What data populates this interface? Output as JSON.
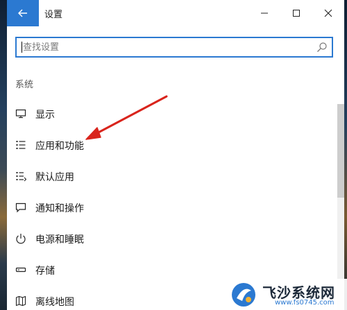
{
  "window": {
    "title": "设置"
  },
  "search": {
    "placeholder": "查找设置",
    "value": ""
  },
  "section": {
    "title": "系统"
  },
  "nav_items": [
    {
      "label": "显示",
      "icon": "monitor-icon"
    },
    {
      "label": "应用和功能",
      "icon": "apps-list-icon"
    },
    {
      "label": "默认应用",
      "icon": "default-apps-icon"
    },
    {
      "label": "通知和操作",
      "icon": "notification-icon"
    },
    {
      "label": "电源和睡眠",
      "icon": "power-icon"
    },
    {
      "label": "存储",
      "icon": "storage-icon"
    },
    {
      "label": "离线地图",
      "icon": "map-icon"
    }
  ],
  "watermark": {
    "text": "飞沙系统网",
    "url": "www.fs0745.com"
  },
  "colors": {
    "accent": "#2b79d1",
    "annotation_arrow": "#d9241c"
  }
}
